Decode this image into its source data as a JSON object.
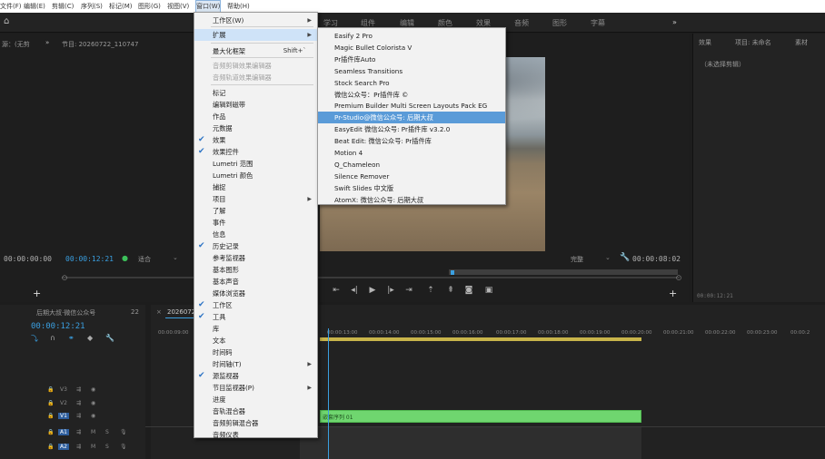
{
  "menubar": {
    "items": [
      "文件(F)",
      "编辑(E)",
      "剪辑(C)",
      "序列(S)",
      "标记(M)",
      "图形(G)",
      "视图(V)",
      "窗口(W)",
      "帮助(H)"
    ]
  },
  "workspace": {
    "tabs": [
      "学习",
      "组件",
      "编辑",
      "颜色",
      "效果",
      "音频",
      "图形",
      "字幕"
    ],
    "overflow": "»"
  },
  "source_panel": {
    "title": "源：(无剪",
    "timecode": "00:00:00:00"
  },
  "program_panel": {
    "title": "节目: 20260722_110747",
    "timecode_current": "00:00:12:21",
    "fit_label": "适合",
    "quality_label": "完整",
    "timecode_duration": "00:00:08:02"
  },
  "right_panel": {
    "tabs": [
      "效果",
      "项目: 未命名",
      "素材"
    ],
    "selector": "（未选择剪辑）",
    "timecode": "00:00:12:21"
  },
  "project_panel": {
    "title": "后期大叔·微信公众号",
    "count": "22"
  },
  "timeline": {
    "tab": "20260722",
    "timecode": "00:00:12:21",
    "ruler": [
      "00:00:09:00",
      "00:00:13:00",
      "00:00:14:00",
      "00:00:15:00",
      "00:00:16:00",
      "00:00:17:00",
      "00:00:18:00",
      "00:00:19:00",
      "00:00:20:00",
      "00:00:21:00",
      "00:00:22:00",
      "00:00:23:00",
      "00:00:2"
    ],
    "tracks": [
      "V3",
      "V2",
      "V1",
      "A1",
      "A2"
    ],
    "clip_label": "嵌套序列 01"
  },
  "window_menu": {
    "items": [
      {
        "label": "工作区(W)",
        "submenu": true
      },
      {
        "label": "扩展",
        "submenu": true,
        "highlight": true
      },
      {
        "label": "最大化框架",
        "shortcut": "Shift+`"
      },
      {
        "label": "音频剪辑效果编辑器",
        "disabled": true
      },
      {
        "label": "音频轨道效果编辑器",
        "disabled": true
      },
      {
        "label": "标记"
      },
      {
        "label": "编辑到磁带"
      },
      {
        "label": "作品"
      },
      {
        "label": "元数据"
      },
      {
        "label": "效果",
        "checked": true
      },
      {
        "label": "效果控件",
        "checked": true
      },
      {
        "label": "Lumetri 范围"
      },
      {
        "label": "Lumetri 颜色"
      },
      {
        "label": "捕捉"
      },
      {
        "label": "项目",
        "submenu": true
      },
      {
        "label": "了解"
      },
      {
        "label": "事件"
      },
      {
        "label": "信息"
      },
      {
        "label": "历史记录",
        "checked": true
      },
      {
        "label": "参考监视器"
      },
      {
        "label": "基本图形"
      },
      {
        "label": "基本声音"
      },
      {
        "label": "媒体浏览器"
      },
      {
        "label": "工作区",
        "checked": true
      },
      {
        "label": "工具",
        "checked": true
      },
      {
        "label": "库"
      },
      {
        "label": "文本"
      },
      {
        "label": "时间码"
      },
      {
        "label": "时间轴(T)",
        "submenu": true
      },
      {
        "label": "源监视器",
        "checked": true
      },
      {
        "label": "节目监视器(P)",
        "submenu": true
      },
      {
        "label": "进度"
      },
      {
        "label": "音轨混合器"
      },
      {
        "label": "音频剪辑混合器"
      },
      {
        "label": "音频仪表"
      }
    ]
  },
  "extensions_menu": {
    "items": [
      {
        "label": "Easify 2 Pro"
      },
      {
        "label": "Magic Bullet Colorista V"
      },
      {
        "label": "Pr插件库Auto"
      },
      {
        "label": "Seamless Transitions"
      },
      {
        "label": "Stock Search Pro"
      },
      {
        "label": "微信公众号：Pr插件库 ©"
      },
      {
        "label": "Premium Builder Multi Screen Layouts Pack EG"
      },
      {
        "label": "Pr-Studio@微信公众号: 后期大叔",
        "highlight": true
      },
      {
        "label": "EasyEdit 微信公众号: Pr插件库 v3.2.0"
      },
      {
        "label": "Beat Edit: 微信公众号: Pr插件库"
      },
      {
        "label": "Motion 4"
      },
      {
        "label": "Q_Chameleon"
      },
      {
        "label": "Silence Remover"
      },
      {
        "label": "Swift Slides 中文版"
      },
      {
        "label": "AtomX: 微信公众号: 后期大叔"
      }
    ]
  },
  "colors": {
    "accent": "#3a9fe0",
    "clip_green": "#6fd66f",
    "menu_highlight": "#5a9bd8"
  }
}
